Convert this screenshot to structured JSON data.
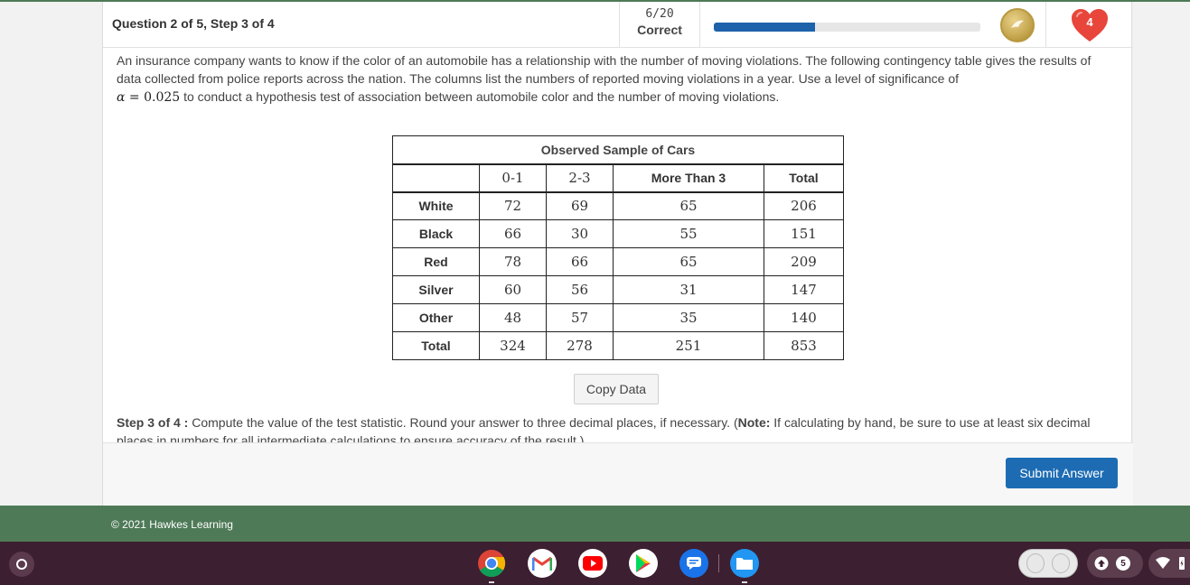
{
  "header": {
    "question_title": "Question 2 of 5, Step 3 of 4",
    "score_count": "6/20",
    "score_label": "Correct",
    "progress_fraction": 0.38,
    "hearts": "4"
  },
  "problem": {
    "text_before": "An insurance company wants to know if the color of an automobile has a relationship with the number of moving violations. The following contingency table gives the results of data collected from police reports across the nation. The columns list the numbers of reported moving violations in a year. Use a level of significance of",
    "alpha_symbol": "α",
    "alpha_eq": " = 0.025",
    "text_after": "to conduct a hypothesis test of association between automobile color and the number of moving violations."
  },
  "table": {
    "caption": "Observed Sample of Cars",
    "headers": [
      "",
      "0-1",
      "2-3",
      "More Than 3",
      "Total"
    ],
    "rows": [
      {
        "label": "White",
        "values": [
          "72",
          "69",
          "65",
          "206"
        ]
      },
      {
        "label": "Black",
        "values": [
          "66",
          "30",
          "55",
          "151"
        ]
      },
      {
        "label": "Red",
        "values": [
          "78",
          "66",
          "65",
          "209"
        ]
      },
      {
        "label": "Silver",
        "values": [
          "60",
          "56",
          "31",
          "147"
        ]
      },
      {
        "label": "Other",
        "values": [
          "48",
          "57",
          "35",
          "140"
        ]
      },
      {
        "label": "Total",
        "values": [
          "324",
          "278",
          "251",
          "853"
        ]
      }
    ]
  },
  "copy_button": "Copy Data",
  "step": {
    "label": "Step 3 of 4 :",
    "text": "Compute the value of the test statistic. Round your answer to three decimal places, if necessary. (",
    "note_label": "Note:",
    "note_text": "If calculating by hand, be sure to use at least six decimal places in numbers for all intermediate calculations to ensure accuracy of the result.)"
  },
  "submit_button": "Submit Answer",
  "footer": {
    "copyright": "© 2021 Hawkes Learning"
  },
  "shelf": {
    "notification_count": "5",
    "colors": {
      "chrome": "#4285f4",
      "gmail": "#ffffff",
      "youtube": "#ff0000",
      "play": "#ffffff",
      "messages": "#1a73e8",
      "files": "#2196f3"
    }
  }
}
